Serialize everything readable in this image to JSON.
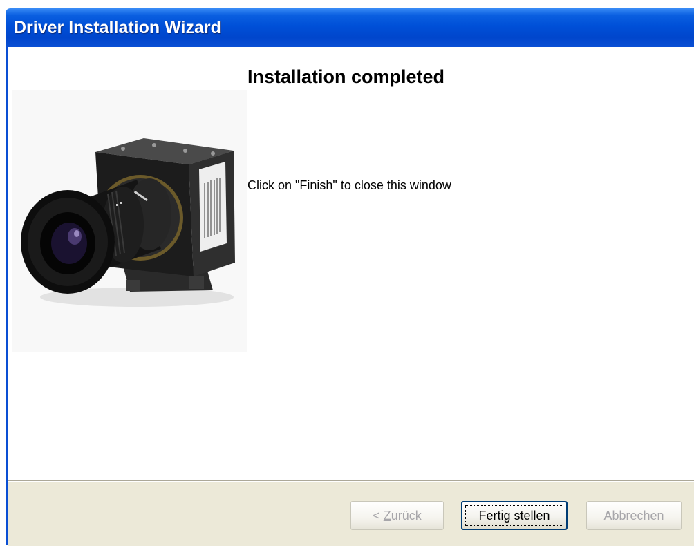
{
  "window": {
    "title": "Driver Installation Wizard"
  },
  "page": {
    "heading": "Installation completed",
    "message": "Click on \"Finish\" to close this window",
    "image_icon": "camera-product-photo"
  },
  "buttons": {
    "back_prefix": "< ",
    "back_mnemonic": "Z",
    "back_rest": "urück",
    "finish_label": "Fertig stellen",
    "cancel_label": "Abbrechen"
  },
  "colors": {
    "title_bar": "#0050d8",
    "button_panel": "#ece9d8",
    "disabled_text": "#a7a6aa",
    "default_button_border": "#003c74"
  }
}
